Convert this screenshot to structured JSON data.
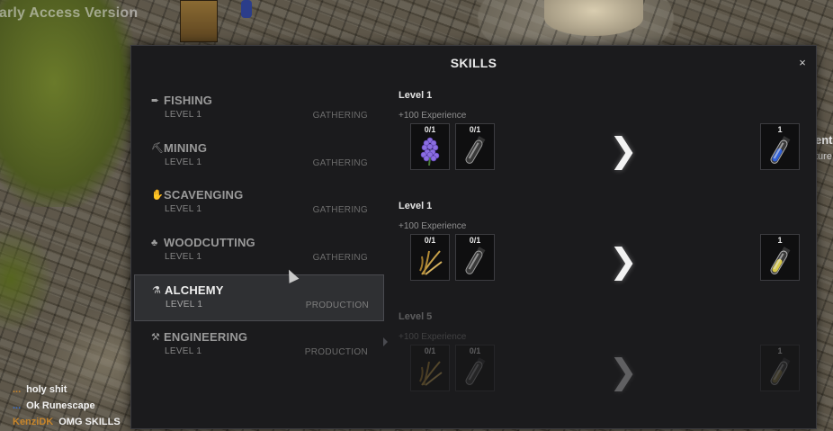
{
  "watermark": "Early Access Version",
  "modal": {
    "title": "SKILLS",
    "close_label": "×"
  },
  "skills": [
    {
      "name": "FISHING",
      "level": "LEVEL 1",
      "category": "GATHERING",
      "icon": "fish-icon",
      "glyph": "➨"
    },
    {
      "name": "MINING",
      "level": "LEVEL 1",
      "category": "GATHERING",
      "icon": "pickaxe-icon",
      "glyph": "⛏"
    },
    {
      "name": "SCAVENGING",
      "level": "LEVEL 1",
      "category": "GATHERING",
      "icon": "glove-icon",
      "glyph": "✋"
    },
    {
      "name": "WOODCUTTING",
      "level": "LEVEL 1",
      "category": "GATHERING",
      "icon": "tree-icon",
      "glyph": "♣"
    },
    {
      "name": "ALCHEMY",
      "level": "LEVEL 1",
      "category": "PRODUCTION",
      "icon": "flask-icon",
      "glyph": "⚗",
      "active": true
    },
    {
      "name": "ENGINEERING",
      "level": "LEVEL 1",
      "category": "PRODUCTION",
      "icon": "hammer-icon",
      "glyph": "⚒"
    }
  ],
  "recipes": [
    {
      "level": "Level 1",
      "xp": "+100 Experience",
      "locked": false,
      "inputs": [
        {
          "count": "0/1",
          "item": "lavender"
        },
        {
          "count": "0/1",
          "item": "empty-vial"
        }
      ],
      "output": {
        "count": "1",
        "item": "blue-potion",
        "color": "#2f5fd8"
      }
    },
    {
      "level": "Level 1",
      "xp": "+100 Experience",
      "locked": false,
      "inputs": [
        {
          "count": "0/1",
          "item": "wheat"
        },
        {
          "count": "0/1",
          "item": "empty-vial"
        }
      ],
      "output": {
        "count": "1",
        "item": "yellow-potion",
        "color": "#d9c94a"
      }
    },
    {
      "level": "Level 5",
      "xp": "+100 Experience",
      "locked": true,
      "inputs": [
        {
          "count": "0/1",
          "item": "wheat"
        },
        {
          "count": "0/1",
          "item": "empty-vial"
        }
      ],
      "output": {
        "count": "1",
        "item": "potion",
        "color": "#8a7a40"
      }
    }
  ],
  "chat": [
    {
      "user": "...",
      "message": "holy shit",
      "color": "#c8852a"
    },
    {
      "user": "...",
      "message": "Ok Runescape",
      "color": "#3c6fc8"
    },
    {
      "user": "KenziDK",
      "message": "OMG SKILLS",
      "color": "#c8852a"
    }
  ],
  "world": {
    "npc_name": "ent",
    "npc_sub": "ture"
  }
}
